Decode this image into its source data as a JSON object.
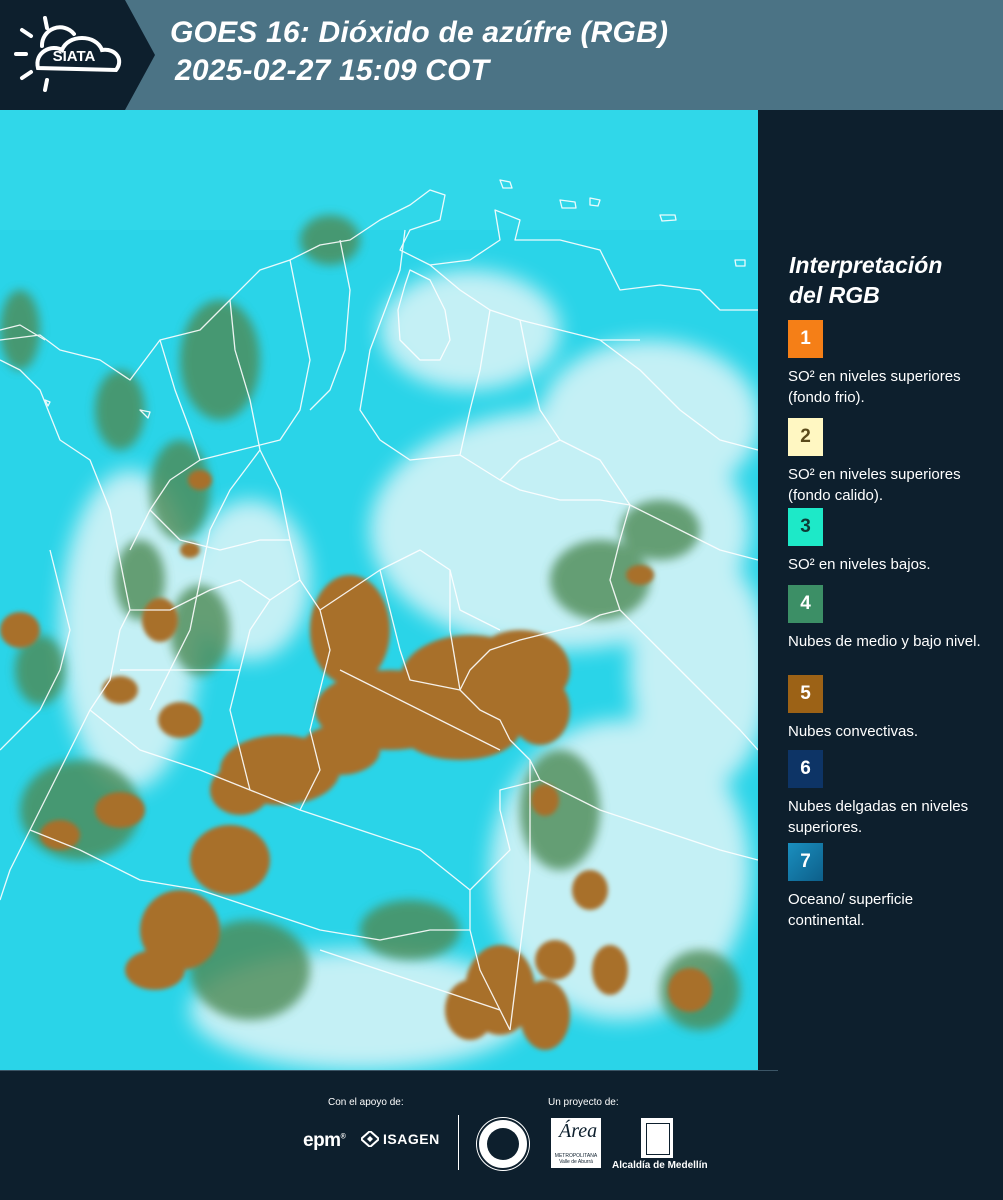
{
  "header": {
    "logo_text": "SIATA",
    "title_line1": "GOES 16: Dióxido de azúfre (RGB)",
    "title_line2": "2025-02-27 15:09 COT",
    "background_color": "#4b7385"
  },
  "legend": {
    "title_line1": "Interpretación",
    "title_line2": "del RGB",
    "items": [
      {
        "number": "1",
        "color": "#f57f17",
        "number_color": "#ffffff",
        "description": "SO² en niveles superiores (fondo frio)."
      },
      {
        "number": "2",
        "color": "#fff7c2",
        "number_color": "#5a4a1a",
        "description": "SO² en niveles superiores (fondo calido)."
      },
      {
        "number": "3",
        "color": "#1de9c8",
        "number_color": "#0d3b36",
        "description": "SO² en niveles bajos."
      },
      {
        "number": "4",
        "color": "#3c8f66",
        "number_color": "#ffffff",
        "description": "Nubes de medio y bajo nivel."
      },
      {
        "number": "5",
        "color": "#9c6216",
        "number_color": "#ffffff",
        "description": "Nubes convectivas."
      },
      {
        "number": "6",
        "color": "#0d3466",
        "number_color": "#ffffff",
        "description": "Nubes delgadas en niveles superiores."
      },
      {
        "number": "7",
        "color": "#1a8fbf",
        "number_color": "#ffffff",
        "description": "Oceano/ superficie continental."
      }
    ]
  },
  "map": {
    "colors": {
      "ocean_surface": "#2ad4e8",
      "haze": "#d9f3f7",
      "convective": "#a8702a",
      "low_mid_clouds": "#3c8f66",
      "borders": "#ffffff"
    }
  },
  "footer": {
    "support_label": "Con el apoyo de:",
    "project_label": "Un proyecto de:",
    "sponsor_epm": "epm",
    "sponsor_epm_mark": "®",
    "sponsor_isagen": "ISAGEN",
    "area_logo_text": "Área",
    "area_logo_subtext": "METROPOLITANA Valle de Aburrá",
    "alcaldia_label": "Alcaldía de Medellín"
  }
}
